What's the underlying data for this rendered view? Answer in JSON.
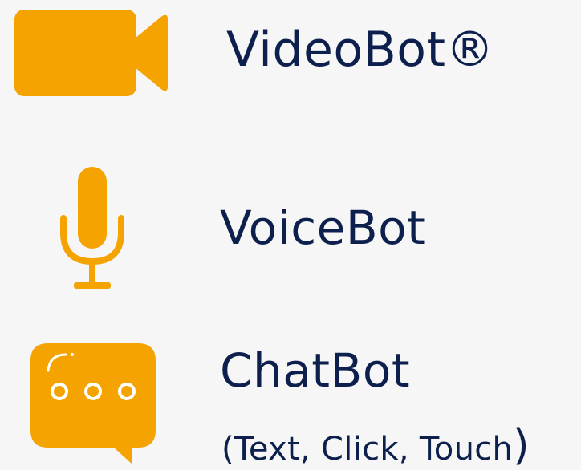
{
  "colors": {
    "icon": "#f5a300",
    "text": "#0c1f4d",
    "background": "#f6f6f6"
  },
  "items": [
    {
      "icon": "video-camera-icon",
      "label": "VideoBot®"
    },
    {
      "icon": "microphone-icon",
      "label": "VoiceBot"
    },
    {
      "icon": "chat-bubble-icon",
      "label": "ChatBot",
      "sublabel_text": "(Text, Click, Touch",
      "sublabel_close": ")"
    }
  ]
}
